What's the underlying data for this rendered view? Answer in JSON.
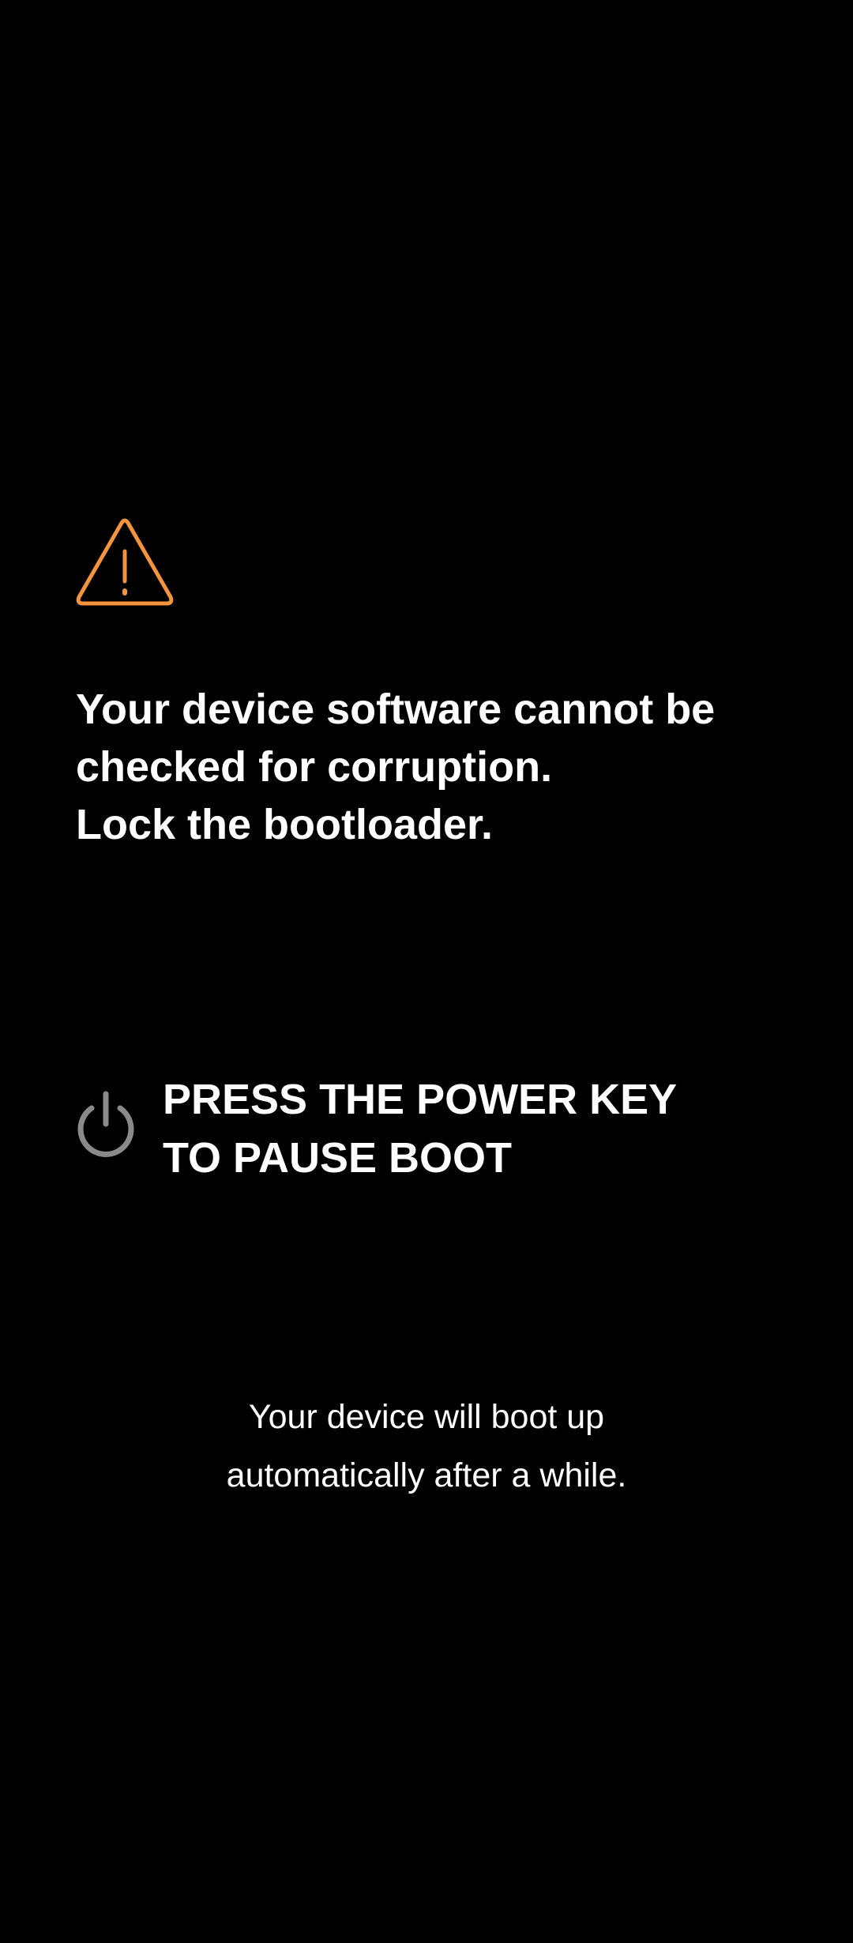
{
  "screen": {
    "background": "#000000"
  },
  "warning": {
    "icon": "warning-triangle-icon",
    "icon_color": "#f5943c",
    "lines": [
      "Your device software cannot be",
      "checked for corruption.",
      "Lock the bootloader."
    ]
  },
  "power_prompt": {
    "icon": "power-icon",
    "icon_color": "#8a8a8a",
    "lines": [
      "PRESS THE POWER KEY",
      "TO PAUSE BOOT"
    ]
  },
  "boot_note": {
    "lines": [
      "Your device will boot up",
      "automatically after a while."
    ]
  }
}
